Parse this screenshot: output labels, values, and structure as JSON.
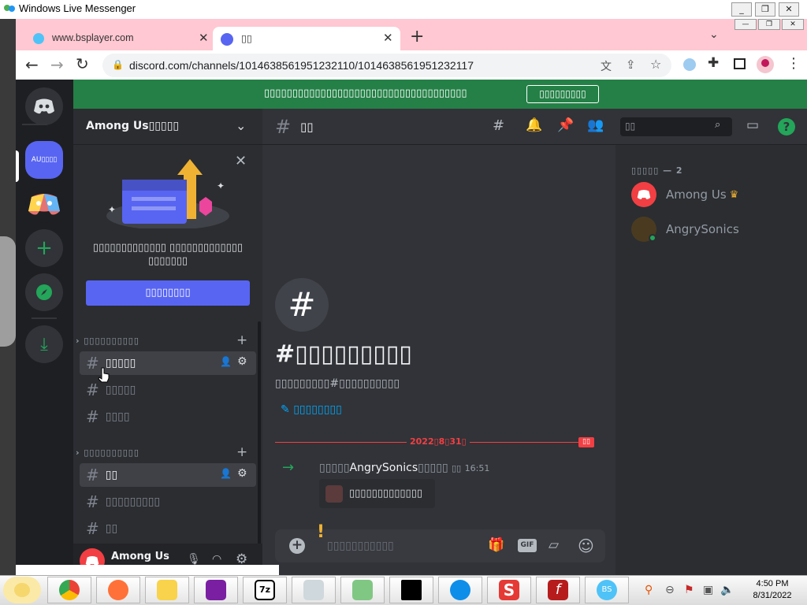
{
  "window": {
    "title": "Windows Live Messenger"
  },
  "browser": {
    "tabs": [
      {
        "title": "www.bsplayer.com"
      },
      {
        "title": "▯▯"
      }
    ],
    "url": "discord.com/channels/1014638561951232110/1014638561951232117"
  },
  "banner": {
    "text": "▯▯▯▯▯▯▯▯▯▯▯▯▯▯▯▯▯▯▯▯▯▯▯▯▯▯▯▯▯▯▯▯▯▯▯▯",
    "button": "▯▯▯▯▯▯▯▯▯"
  },
  "server": {
    "name": "Among Us▯▯▯▯▯",
    "selected_icon_label": "AU▯▯▯▯"
  },
  "promo": {
    "text_line1": "▯▯▯▯▯▯▯▯▯▯▯▯▯ ▯▯▯▯▯▯▯▯▯▯▯▯▯",
    "text_line2": "▯▯▯▯▯▯▯",
    "button": "▯▯▯▯▯▯▯▯"
  },
  "categories": [
    {
      "name": "▯▯▯▯▯▯▯▯▯▯",
      "channels": [
        {
          "name": "▯▯▯▯▯"
        },
        {
          "name": "▯▯▯▯▯"
        },
        {
          "name": "▯▯▯▯"
        }
      ]
    },
    {
      "name": "▯▯▯▯▯▯▯▯▯▯",
      "channels": [
        {
          "name": "▯▯"
        },
        {
          "name": "▯▯▯▯▯▯▯▯▯"
        },
        {
          "name": "▯▯"
        }
      ]
    }
  ],
  "user": {
    "name": "Among Us"
  },
  "chat": {
    "channel_name": "▯▯",
    "search_placeholder": "▯▯",
    "welcome_title": "#▯▯▯▯▯▯▯▯▯",
    "welcome_sub": "▯▯▯▯▯▯▯▯▯#▯▯▯▯▯▯▯▯▯▯",
    "edit_link": "▯▯▯▯▯▯▯▯",
    "date_divider": "2022▯8▯31▯",
    "new_badge": "▯▯",
    "message": {
      "prefix": "▯▯▯▯▯",
      "user": "AngrySonics",
      "suffix": "▯▯▯▯▯",
      "time_prefix": "▯▯",
      "time": "16:51",
      "sticker_text": "▯▯▯▯▯▯▯▯▯▯▯▯▯"
    },
    "composer_placeholder": "▯▯▯▯▯▯▯▯▯▯▯"
  },
  "members": {
    "header": "▯▯▯▯▯ — 2",
    "list": [
      {
        "name": "Among Us",
        "owner": "♛"
      },
      {
        "name": "AngrySonics"
      }
    ]
  },
  "taskbar": {
    "time": "4:50 PM",
    "date": "8/31/2022"
  },
  "colors": {
    "discord_bg": "#313338",
    "green_banner": "#248046",
    "blurple": "#5865f2",
    "chrome_tabs": "#ffc8d2"
  }
}
